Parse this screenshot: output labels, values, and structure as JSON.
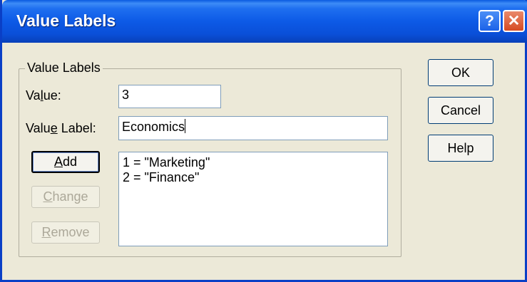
{
  "window": {
    "title": "Value Labels",
    "help_glyph": "?",
    "close_glyph": "✕"
  },
  "group": {
    "legend": "Value Labels"
  },
  "form": {
    "value_label_pre": "Va",
    "value_label_accel": "l",
    "value_label_post": "ue:",
    "value_input": "3",
    "valuelabel_label_pre": "Valu",
    "valuelabel_label_accel": "e",
    "valuelabel_label_post": " Label:",
    "valuelabel_input": "Economics"
  },
  "buttons": {
    "add": {
      "accel": "A",
      "rest": "dd"
    },
    "change": {
      "accel": "C",
      "rest": "hange"
    },
    "remove": {
      "accel": "R",
      "rest": "emove"
    },
    "ok": "OK",
    "cancel": "Cancel",
    "help": "Help"
  },
  "labels_list": [
    "1 = \"Marketing\"",
    "2 = \"Finance\""
  ],
  "colors": {
    "titlebar": "#0a4fd8",
    "dialog_bg": "#ece9d8",
    "close_button": "#d64a22"
  }
}
